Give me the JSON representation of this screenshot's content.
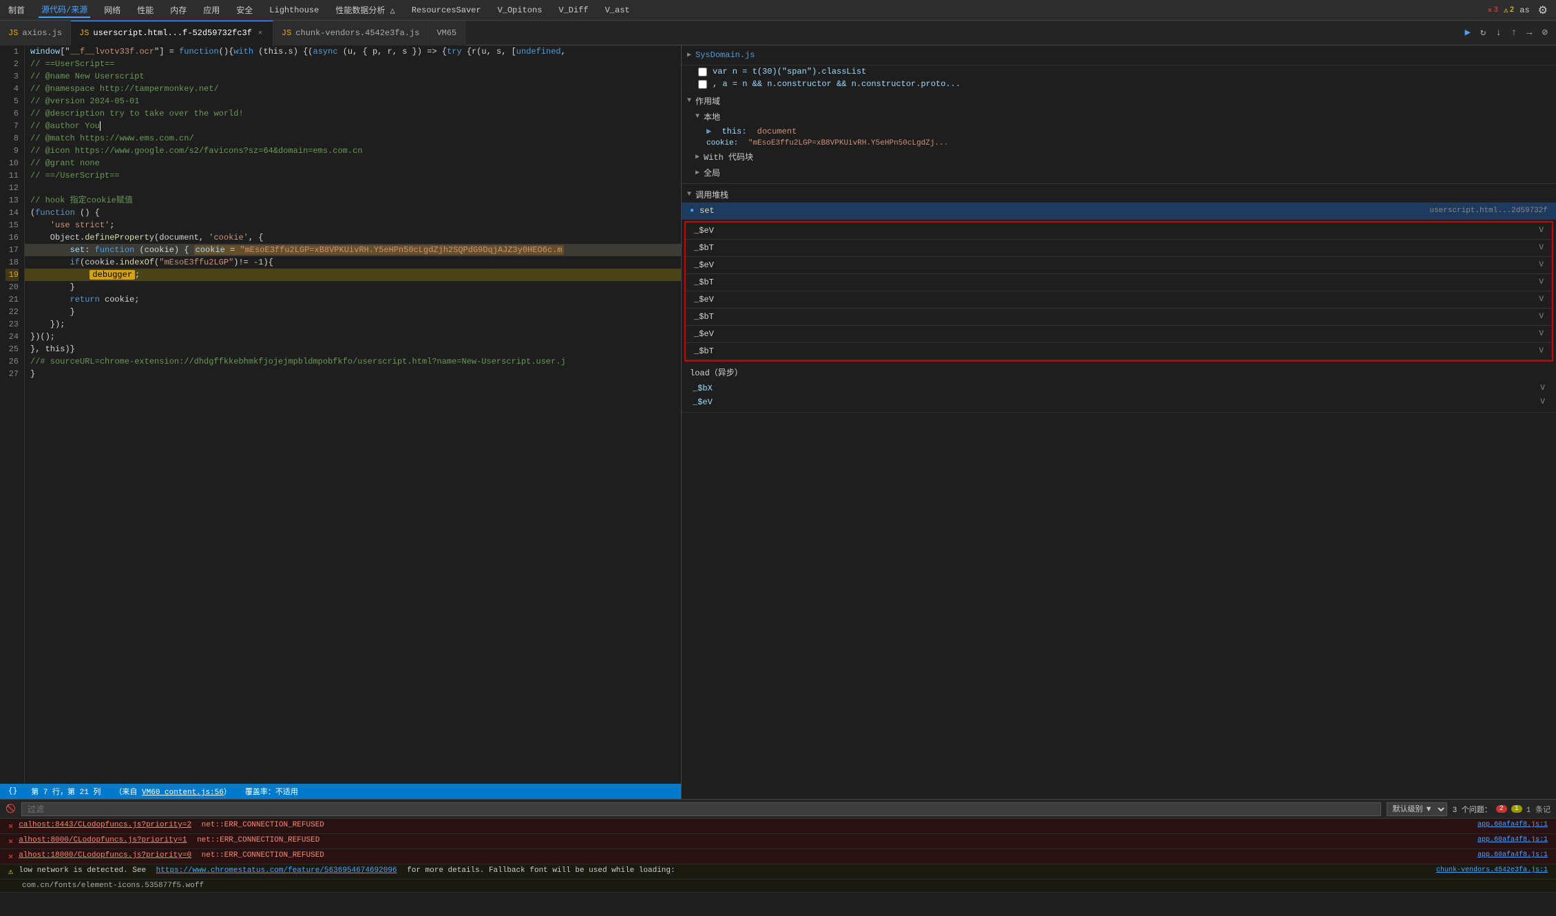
{
  "toolbar": {
    "items": [
      "制首",
      "源代码/来源",
      "网络",
      "性能",
      "内存",
      "应用",
      "安全",
      "Lighthouse",
      "性能数据分析 △",
      "ResourcesSaver",
      "V_Opitons",
      "V_Diff",
      "V_ast"
    ]
  },
  "tabs": [
    {
      "id": "axios",
      "label": "axios.js",
      "active": false,
      "closable": false
    },
    {
      "id": "userscript",
      "label": "userscript.html...f-52d59732fc3f",
      "active": true,
      "closable": true
    },
    {
      "id": "chunk-vendors",
      "label": "chunk-vendors.4542e3fa.js",
      "active": false,
      "closable": false
    },
    {
      "id": "vm65",
      "label": "VM65",
      "active": false,
      "closable": false
    }
  ],
  "code": {
    "lines": [
      {
        "num": 1,
        "content": "window[\"__f__lvotv33f.ocr\"] = function(){with (this.s) {async (u, { p, r, s }) => {try {r(u, s, [undefined,",
        "type": "normal"
      },
      {
        "num": 2,
        "content": "// ==UserScript==",
        "type": "comment"
      },
      {
        "num": 3,
        "content": "// @name         New Userscript",
        "type": "comment"
      },
      {
        "num": 4,
        "content": "// @namespace     http://tampermonkey.net/",
        "type": "comment"
      },
      {
        "num": 5,
        "content": "// @version       2024-05-01",
        "type": "comment"
      },
      {
        "num": 6,
        "content": "// @description   try to take over the world!",
        "type": "comment"
      },
      {
        "num": 7,
        "content": "// @author        You",
        "type": "comment-cursor"
      },
      {
        "num": 8,
        "content": "// @match         https://www.ems.com.cn/",
        "type": "comment"
      },
      {
        "num": 9,
        "content": "// @icon          https://www.google.com/s2/favicons?sz=64&domain=ems.com.cn",
        "type": "comment"
      },
      {
        "num": 10,
        "content": "// @grant         none",
        "type": "comment"
      },
      {
        "num": 11,
        "content": "// ==/UserScript==",
        "type": "comment"
      },
      {
        "num": 12,
        "content": "",
        "type": "normal"
      },
      {
        "num": 13,
        "content": "// hook  指定cookie赋值",
        "type": "comment"
      },
      {
        "num": 14,
        "content": "(function () {",
        "type": "normal"
      },
      {
        "num": 15,
        "content": "    'use strict';",
        "type": "normal"
      },
      {
        "num": 16,
        "content": "    Object.defineProperty(document, 'cookie', {",
        "type": "normal"
      },
      {
        "num": 17,
        "content": "        set: function (cookie) {  cookie = \"mEsoE3ffu2LGP=xB8VPKUivRH.Y5eHPn50cLgdZjh2SQPdG9DqjAJZ3y0HEO6c.m",
        "type": "highlighted"
      },
      {
        "num": 18,
        "content": "        if(cookie.indexOf(\"mEsoE3ffu2LGP\")!= -1){",
        "type": "normal"
      },
      {
        "num": 19,
        "content": "            debugger;",
        "type": "debugger-line"
      },
      {
        "num": 20,
        "content": "        }",
        "type": "normal"
      },
      {
        "num": 21,
        "content": "        return cookie;",
        "type": "normal"
      },
      {
        "num": 22,
        "content": "        }",
        "type": "normal"
      },
      {
        "num": 23,
        "content": "    });",
        "type": "normal"
      },
      {
        "num": 24,
        "content": "})();",
        "type": "normal"
      },
      {
        "num": 25,
        "content": "}, this)}",
        "type": "normal"
      },
      {
        "num": 26,
        "content": "//# sourceURL=chrome-extension://dhdgffkkebhmkfjojejmpbldmpobfkfo/userscript.html?name=New-Userscript.user.j",
        "type": "comment"
      },
      {
        "num": 27,
        "content": "}",
        "type": "normal"
      }
    ]
  },
  "status_bar": {
    "position": "第 7 行，第 21 列",
    "source": "（来自 VM60 content.js:56）",
    "vm_link": "VM60 content.js:56",
    "coverage": "覆盖率：不适用"
  },
  "right_panel": {
    "scope_sections": [
      {
        "label": "SysDomain.js",
        "collapsed": true
      }
    ],
    "local_items": [
      {
        "key": "var n = t(30)(\"span\").classList",
        "value": ""
      },
      {
        "key": ", a = n && n.constructor && n.constructor.proto...",
        "value": ""
      }
    ],
    "scope_label": "作用域",
    "local_label": "本地",
    "this_key": "this:",
    "this_val": "document",
    "cookie_key": "cookie:",
    "cookie_val": "\"mEsoE3ffu2LGP=xB8VPKUivRH.Y5eHPn50cLgdZj...",
    "with_label": "With 代码块",
    "global_label": "全局",
    "callstack_label": "调用堆栈",
    "callstack_items": [
      {
        "name": "set",
        "loc": "userscript.html...2d59732f",
        "active": true
      },
      {
        "name": "_$eV",
        "loc": "V",
        "active": false
      },
      {
        "name": "_$bT",
        "loc": "V",
        "active": false
      },
      {
        "name": "_$eV",
        "loc": "V",
        "active": false
      },
      {
        "name": "_$bT",
        "loc": "V",
        "active": false
      },
      {
        "name": "_$eV",
        "loc": "V",
        "active": false
      },
      {
        "name": "_$bT",
        "loc": "V",
        "active": false
      },
      {
        "name": "_$eV",
        "loc": "V",
        "active": false
      },
      {
        "name": "_$bT",
        "loc": "V",
        "active": false
      }
    ],
    "load_label": "load（异步）",
    "bottom_vars": [
      {
        "key": "_$bX",
        "val": "V"
      },
      {
        "key": "_$eV",
        "val": "V"
      }
    ]
  },
  "console": {
    "filter_placeholder": "过滤",
    "level_label": "默认级别 ▼",
    "issues_label": "3 个问题：",
    "badge_red": "2",
    "badge_yellow": "1",
    "badge_lines": "1 条记",
    "messages": [
      {
        "type": "error",
        "icon": "✕",
        "text": "calhost:8443/CLodopfuncs.js?priority=2  net::ERR_CONNECTION_REFUSED",
        "link_text": "calhost:8443/CLodopfuncs.js?priority=2",
        "source": "app.60afa4f8.js:1"
      },
      {
        "type": "error",
        "icon": "✕",
        "text": "alhost:8000/CLodopfuncs.js?priority=1  net::ERR_CONNECTION_REFUSED",
        "link_text": "alhost:8000/CLodopfuncs.js?priority=1",
        "source": "app.60afa4f8.js:1"
      },
      {
        "type": "error",
        "icon": "✕",
        "text": "alhost:18000/CLodopfuncs.js?priority=0  net::ERR_CONNECTION_REFUSED",
        "link_text": "alhost:18000/CLodopfuncs.js?priority=0",
        "source": "app.60afa4f8.js:1"
      },
      {
        "type": "warning",
        "icon": "⚠",
        "text": "low network is detected. See https://www.chromestatus.com/feature/5636954674692096 for more details. Fallback font will be used while loading: chunk-vendors.4542e3fa.js:1",
        "link_text_1": "https://www.chromestatus.com/feature/5636954674692096",
        "link_text_2": "chunk-vendors.4542e3fa.js:1",
        "source": "com.cn/fonts/element-icons.535877f5.woff"
      }
    ]
  },
  "top_badges": {
    "errors": "3",
    "warnings": "2",
    "as_label": "as"
  }
}
